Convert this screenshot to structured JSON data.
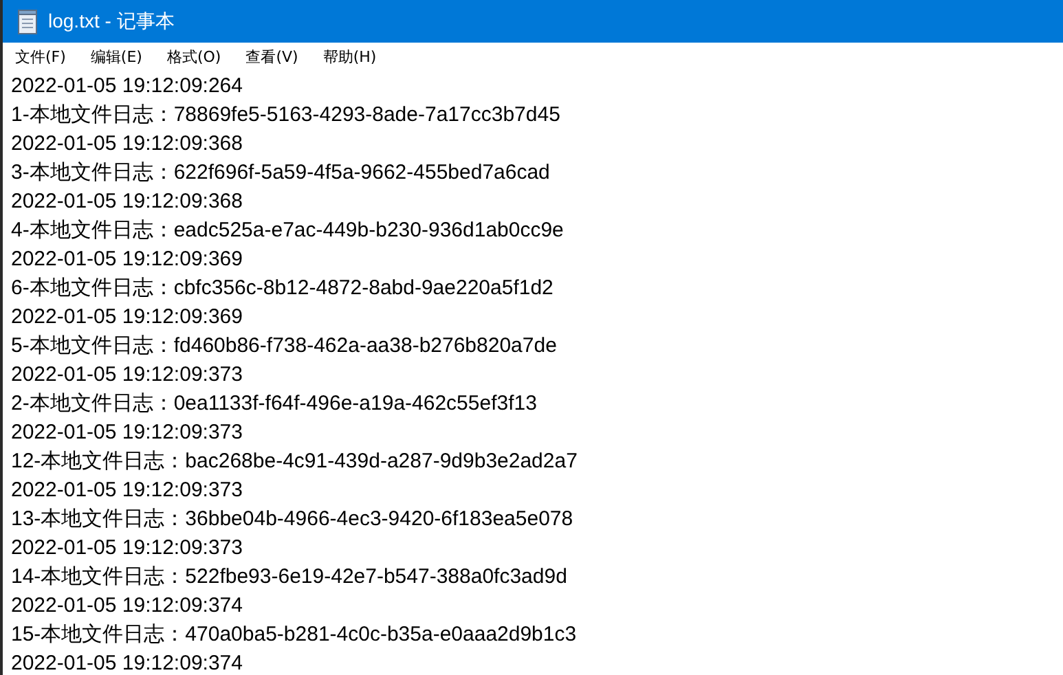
{
  "window": {
    "title": "log.txt - 记事本"
  },
  "menu": [
    {
      "label": "文件(F)"
    },
    {
      "label": "编辑(E)"
    },
    {
      "label": "格式(O)"
    },
    {
      "label": "查看(V)"
    },
    {
      "label": "帮助(H)"
    }
  ],
  "lines": [
    "2022-01-05 19:12:09:264",
    "1-本地文件日志：78869fe5-5163-4293-8ade-7a17cc3b7d45",
    "2022-01-05 19:12:09:368",
    "3-本地文件日志：622f696f-5a59-4f5a-9662-455bed7a6cad",
    "2022-01-05 19:12:09:368",
    "4-本地文件日志：eadc525a-e7ac-449b-b230-936d1ab0cc9e",
    "2022-01-05 19:12:09:369",
    "6-本地文件日志：cbfc356c-8b12-4872-8abd-9ae220a5f1d2",
    "2022-01-05 19:12:09:369",
    "5-本地文件日志：fd460b86-f738-462a-aa38-b276b820a7de",
    "2022-01-05 19:12:09:373",
    "2-本地文件日志：0ea1133f-f64f-496e-a19a-462c55ef3f13",
    "2022-01-05 19:12:09:373",
    "12-本地文件日志：bac268be-4c91-439d-a287-9d9b3e2ad2a7",
    "2022-01-05 19:12:09:373",
    "13-本地文件日志：36bbe04b-4966-4ec3-9420-6f183ea5e078",
    "2022-01-05 19:12:09:373",
    "14-本地文件日志：522fbe93-6e19-42e7-b547-388a0fc3ad9d",
    "2022-01-05 19:12:09:374",
    "15-本地文件日志：470a0ba5-b281-4c0c-b35a-e0aaa2d9b1c3",
    "2022-01-05 19:12:09:374"
  ]
}
